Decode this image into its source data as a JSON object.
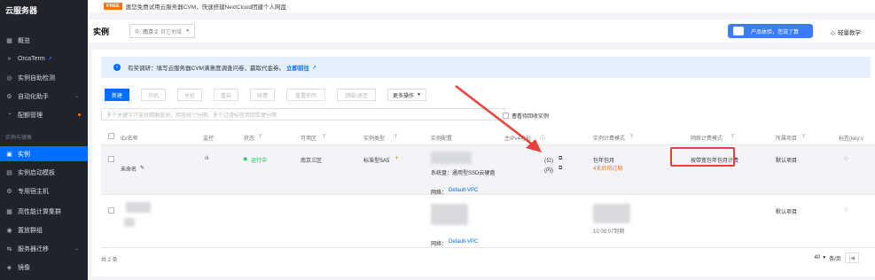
{
  "sidebar": {
    "title": "云服务器",
    "items": [
      {
        "label": "概览",
        "icon": "grid-icon"
      },
      {
        "label": "OrcaTerm",
        "icon": "terminal-icon"
      },
      {
        "label": "实例自助检测",
        "icon": "check-icon"
      },
      {
        "label": "自动化助手",
        "icon": "robot-icon"
      },
      {
        "label": "配额管理",
        "icon": "quota-icon"
      },
      {
        "label": "实例",
        "icon": "monitor-icon"
      },
      {
        "label": "实例启动模板",
        "icon": "template-icon"
      },
      {
        "label": "专用宿主机",
        "icon": "host-icon"
      },
      {
        "label": "高性能计算集群",
        "icon": "cluster-icon"
      },
      {
        "label": "置放群组",
        "icon": "group-icon"
      },
      {
        "label": "服务器迁移",
        "icon": "migrate-icon"
      },
      {
        "label": "镜像",
        "icon": "image-icon"
      }
    ],
    "section_label": "实例与镜像"
  },
  "notice": {
    "badge": "FREE",
    "text": "邀您免费试用云服务器CVM，快速搭建NextCloud团建个人网盘"
  },
  "header": {
    "title": "实例",
    "region": "南京 2",
    "region_extra": "其它地域",
    "promo": "产品体验，您说了算",
    "tutorial": "轻量教学"
  },
  "info": {
    "text": "有奖调研：填写云服务器CVM满意度调查问卷，赢取代金券。",
    "link": "立即前往"
  },
  "toolbar": {
    "buttons": [
      "新建",
      "开机",
      "关机",
      "重启",
      "续费",
      "重置密码",
      "销毁/退还"
    ],
    "more": "更多操作"
  },
  "search": {
    "placeholder": "多个关键字只支持精确查询，用竖线\"|\"分隔，多个过滤标签用回车键分隔",
    "recycle_label": "查看待回收实例"
  },
  "table": {
    "headers": [
      "ID/名称",
      "监控",
      "状态",
      "可用区",
      "实例类型",
      "实例配置",
      "主IPv4地址",
      "实例计费模式",
      "网络计费模式",
      "所属项目",
      "标签(key:v"
    ],
    "row1": {
      "name": "未命名",
      "status": "运行中",
      "zone": "南京三区",
      "type": "标准型SA5",
      "config_disk": "系统盘：通用型SSD云硬盘",
      "config_net_label": "网络：",
      "config_net": "Default-VPC",
      "ip_pub": "(公)",
      "ip_priv": "(内)",
      "billing": "包年包月",
      "expire": "4天后将过期",
      "net_billing": "按带宽包年包月计费",
      "project": "默认项目"
    },
    "row2": {
      "config_net_label": "网络：",
      "config_net": "Default-VPC",
      "time": "10:09:07到期",
      "project": "默认项目"
    }
  },
  "footer": {
    "total": "共 2 条",
    "page_size": "40",
    "page_size_unit": "条/页"
  }
}
